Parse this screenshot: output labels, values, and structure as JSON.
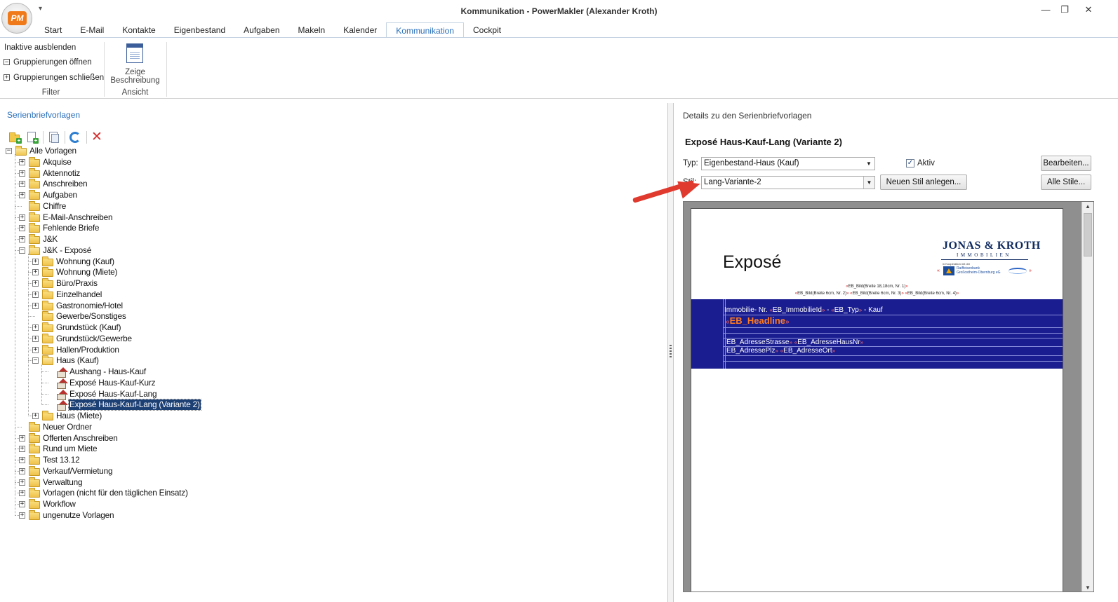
{
  "window": {
    "title": "Kommunikation - PowerMakler (Alexander Kroth)",
    "app_logo_text": "PM",
    "qat_glyph": "▾",
    "minimize": "—",
    "restore": "❐",
    "close": "✕"
  },
  "tabs": [
    "Start",
    "E-Mail",
    "Kontakte",
    "Eigenbestand",
    "Aufgaben",
    "Makeln",
    "Kalender",
    "Kommunikation",
    "Cockpit"
  ],
  "ribbon": {
    "inactive_hide": "Inaktive ausblenden",
    "open_groups": "Gruppierungen öffnen",
    "close_groups": "Gruppierungen schließen",
    "filter_group": "Filter",
    "show_desc_line1": "Zeige",
    "show_desc_line2": "Beschreibung",
    "view_group": "Ansicht"
  },
  "left": {
    "header": "Serienbriefvorlagen"
  },
  "tree": [
    {
      "label": "Alle Vorlagen",
      "level": 0,
      "toggle": "−",
      "icon": "folder-open"
    },
    {
      "label": "Akquise",
      "level": 1,
      "toggle": "+",
      "icon": "folder"
    },
    {
      "label": "Aktennotiz",
      "level": 1,
      "toggle": "+",
      "icon": "folder"
    },
    {
      "label": "Anschreiben",
      "level": 1,
      "toggle": "+",
      "icon": "folder"
    },
    {
      "label": "Aufgaben",
      "level": 1,
      "toggle": "+",
      "icon": "folder"
    },
    {
      "label": "Chiffre",
      "level": 1,
      "toggle": "",
      "icon": "folder"
    },
    {
      "label": "E-Mail-Anschreiben",
      "level": 1,
      "toggle": "+",
      "icon": "folder"
    },
    {
      "label": "Fehlende Briefe",
      "level": 1,
      "toggle": "+",
      "icon": "folder"
    },
    {
      "label": "J&K",
      "level": 1,
      "toggle": "+",
      "icon": "folder"
    },
    {
      "label": "J&K - Exposé",
      "level": 1,
      "toggle": "−",
      "icon": "folder-open"
    },
    {
      "label": "Wohnung (Kauf)",
      "level": 2,
      "toggle": "+",
      "icon": "folder"
    },
    {
      "label": "Wohnung (Miete)",
      "level": 2,
      "toggle": "+",
      "icon": "folder"
    },
    {
      "label": "Büro/Praxis",
      "level": 2,
      "toggle": "+",
      "icon": "folder"
    },
    {
      "label": "Einzelhandel",
      "level": 2,
      "toggle": "+",
      "icon": "folder"
    },
    {
      "label": "Gastronomie/Hotel",
      "level": 2,
      "toggle": "+",
      "icon": "folder"
    },
    {
      "label": "Gewerbe/Sonstiges",
      "level": 2,
      "toggle": "",
      "icon": "folder"
    },
    {
      "label": "Grundstück (Kauf)",
      "level": 2,
      "toggle": "+",
      "icon": "folder"
    },
    {
      "label": "Grundstück/Gewerbe",
      "level": 2,
      "toggle": "+",
      "icon": "folder"
    },
    {
      "label": "Hallen/Produktion",
      "level": 2,
      "toggle": "+",
      "icon": "folder"
    },
    {
      "label": "Haus (Kauf)",
      "level": 2,
      "toggle": "−",
      "icon": "folder-open"
    },
    {
      "label": "Aushang - Haus-Kauf",
      "level": 3,
      "toggle": "",
      "icon": "house"
    },
    {
      "label": "Exposé Haus-Kauf-Kurz",
      "level": 3,
      "toggle": "",
      "icon": "house"
    },
    {
      "label": "Exposé Haus-Kauf-Lang",
      "level": 3,
      "toggle": "",
      "icon": "house"
    },
    {
      "label": "Exposé Haus-Kauf-Lang (Variante 2)",
      "level": 3,
      "toggle": "",
      "icon": "house",
      "selected": true
    },
    {
      "label": "Haus (Miete)",
      "level": 2,
      "toggle": "+",
      "icon": "folder"
    },
    {
      "label": "Neuer Ordner",
      "level": 1,
      "toggle": "",
      "icon": "folder"
    },
    {
      "label": "Offerten Anschreiben",
      "level": 1,
      "toggle": "+",
      "icon": "folder"
    },
    {
      "label": "Rund um Miete",
      "level": 1,
      "toggle": "+",
      "icon": "folder"
    },
    {
      "label": "Test 13.12",
      "level": 1,
      "toggle": "+",
      "icon": "folder"
    },
    {
      "label": "Verkauf/Vermietung",
      "level": 1,
      "toggle": "+",
      "icon": "folder"
    },
    {
      "label": "Verwaltung",
      "level": 1,
      "toggle": "+",
      "icon": "folder"
    },
    {
      "label": "Vorlagen (nicht für den täglichen Einsatz)",
      "level": 1,
      "toggle": "+",
      "icon": "folder"
    },
    {
      "label": "Workflow",
      "level": 1,
      "toggle": "+",
      "icon": "folder"
    },
    {
      "label": "ungenutze Vorlagen",
      "level": 1,
      "toggle": "+",
      "icon": "folder"
    }
  ],
  "right": {
    "header": "Details zu den Serienbriefvorlagen",
    "template_title": "Exposé Haus-Kauf-Lang (Variante 2)",
    "type_label": "Typ:",
    "type_value": "Eigenbestand-Haus (Kauf)",
    "active_label": "Aktiv",
    "active_checked": "✓",
    "edit_button": "Bearbeiten...",
    "style_label": "Stil:",
    "style_value": "Lang-Variante-2",
    "new_style_button": "Neuen Stil anlegen...",
    "all_styles_button": "Alle Stile..."
  },
  "preview": {
    "title": "Exposé",
    "logo_main": "JONAS & KROTH",
    "logo_sub": "IMMOBILIEN",
    "logo_small": "in Kooperation mit der",
    "bank_line1": "Raiffeisenbank",
    "bank_line2": "Großostheim-Obernburg eG",
    "merge_line1": "EB_Bild(Breite 18,18cm, Nr. 1)",
    "merge_line2a": "EB_Bild(Breite 6cm, Nr. 2)",
    "merge_line2b": "EB_Bild(Breite 6cm, Nr. 3)",
    "merge_line2c": "EB_Bild(Breite 6cm, Nr. 4)",
    "immo_prefix": "Immobilie- Nr. ",
    "immo_id": "EB_ImmobilieId",
    "immo_sep": " - ",
    "immo_type": "EB_Typ",
    "immo_suffix": " - Kauf",
    "headline": "EB_Headline",
    "street": "EB_AdresseStrasse",
    "house_no": "EB_AdresseHausNr",
    "zip": "EB_AdressePlz",
    "city": "EB_AdresseOrt",
    "open_mark": "«",
    "close_mark": "»"
  },
  "colors": {
    "accent": "#2a6fba",
    "selection": "#1c3f74",
    "band": "#1a1d8f",
    "headline": "#ff7b22",
    "arrow": "#e0392e"
  }
}
